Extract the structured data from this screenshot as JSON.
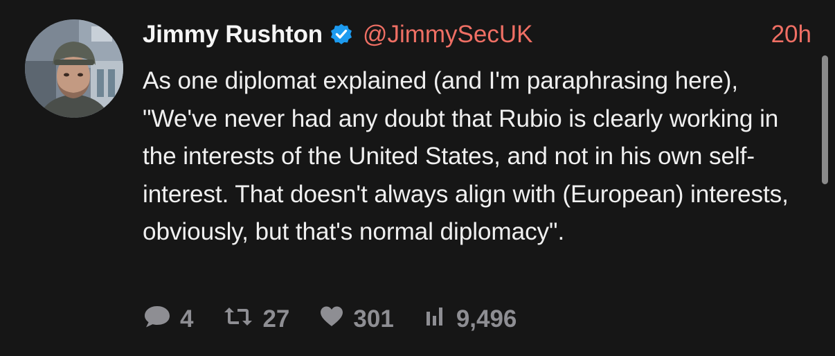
{
  "tweet": {
    "author": {
      "name": "Jimmy Rushton",
      "handle": "@JimmySecUK",
      "verified": true
    },
    "time": "20h",
    "text": "As one diplomat explained (and I'm paraphrasing here), \"We've never had any doubt that Rubio is clearly working in the interests of the United States, and not in his own self-interest. That doesn't always align with (European) interests, obviously, but that's normal diplomacy\".",
    "stats": {
      "replies": "4",
      "retweets": "27",
      "likes": "301",
      "views": "9,496"
    }
  },
  "colors": {
    "background": "#161616",
    "accent": "#ef6f64",
    "muted": "#8e8e93",
    "verified": "#1d9bf0"
  },
  "icons": {
    "replies": "comment-bubble-icon",
    "retweets": "retweet-icon",
    "likes": "heart-icon",
    "views": "bar-chart-icon"
  }
}
